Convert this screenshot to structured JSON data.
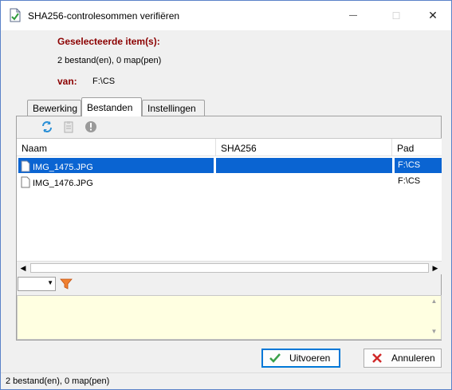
{
  "window": {
    "title": "SHA256-controlesommen verifiëren",
    "close_glyph": "✕",
    "minimize_glyph": "—",
    "maximize_glyph": "☐"
  },
  "header": {
    "selected_label": "Geselecteerde item(s):",
    "selected_value": "2 bestand(en), 0 map(pen)",
    "from_label": "van:",
    "from_value": "F:\\CS"
  },
  "tabs": [
    {
      "label": "Bewerking",
      "active": false
    },
    {
      "label": "Bestanden",
      "active": true
    },
    {
      "label": "Instellingen",
      "active": false
    }
  ],
  "toolbar": {
    "icons": [
      "refresh-icon",
      "clipboard-icon",
      "info-icon"
    ]
  },
  "list": {
    "columns": [
      "Naam",
      "SHA256",
      "Pad"
    ],
    "rows": [
      {
        "name": "IMG_1475.JPG",
        "sha256": "",
        "path": "F:\\CS",
        "selected": true
      },
      {
        "name": "IMG_1476.JPG",
        "sha256": "",
        "path": "F:\\CS",
        "selected": false
      }
    ]
  },
  "filter": {
    "combo_value": ""
  },
  "buttons": {
    "run_label": "Uitvoeren",
    "cancel_label": "Annuleren"
  },
  "status": {
    "text": "2 bestand(en), 0 map(pen)"
  },
  "colors": {
    "accent": "#0a64d2",
    "label_red": "#8b0000",
    "notes_bg": "#ffffe1"
  }
}
